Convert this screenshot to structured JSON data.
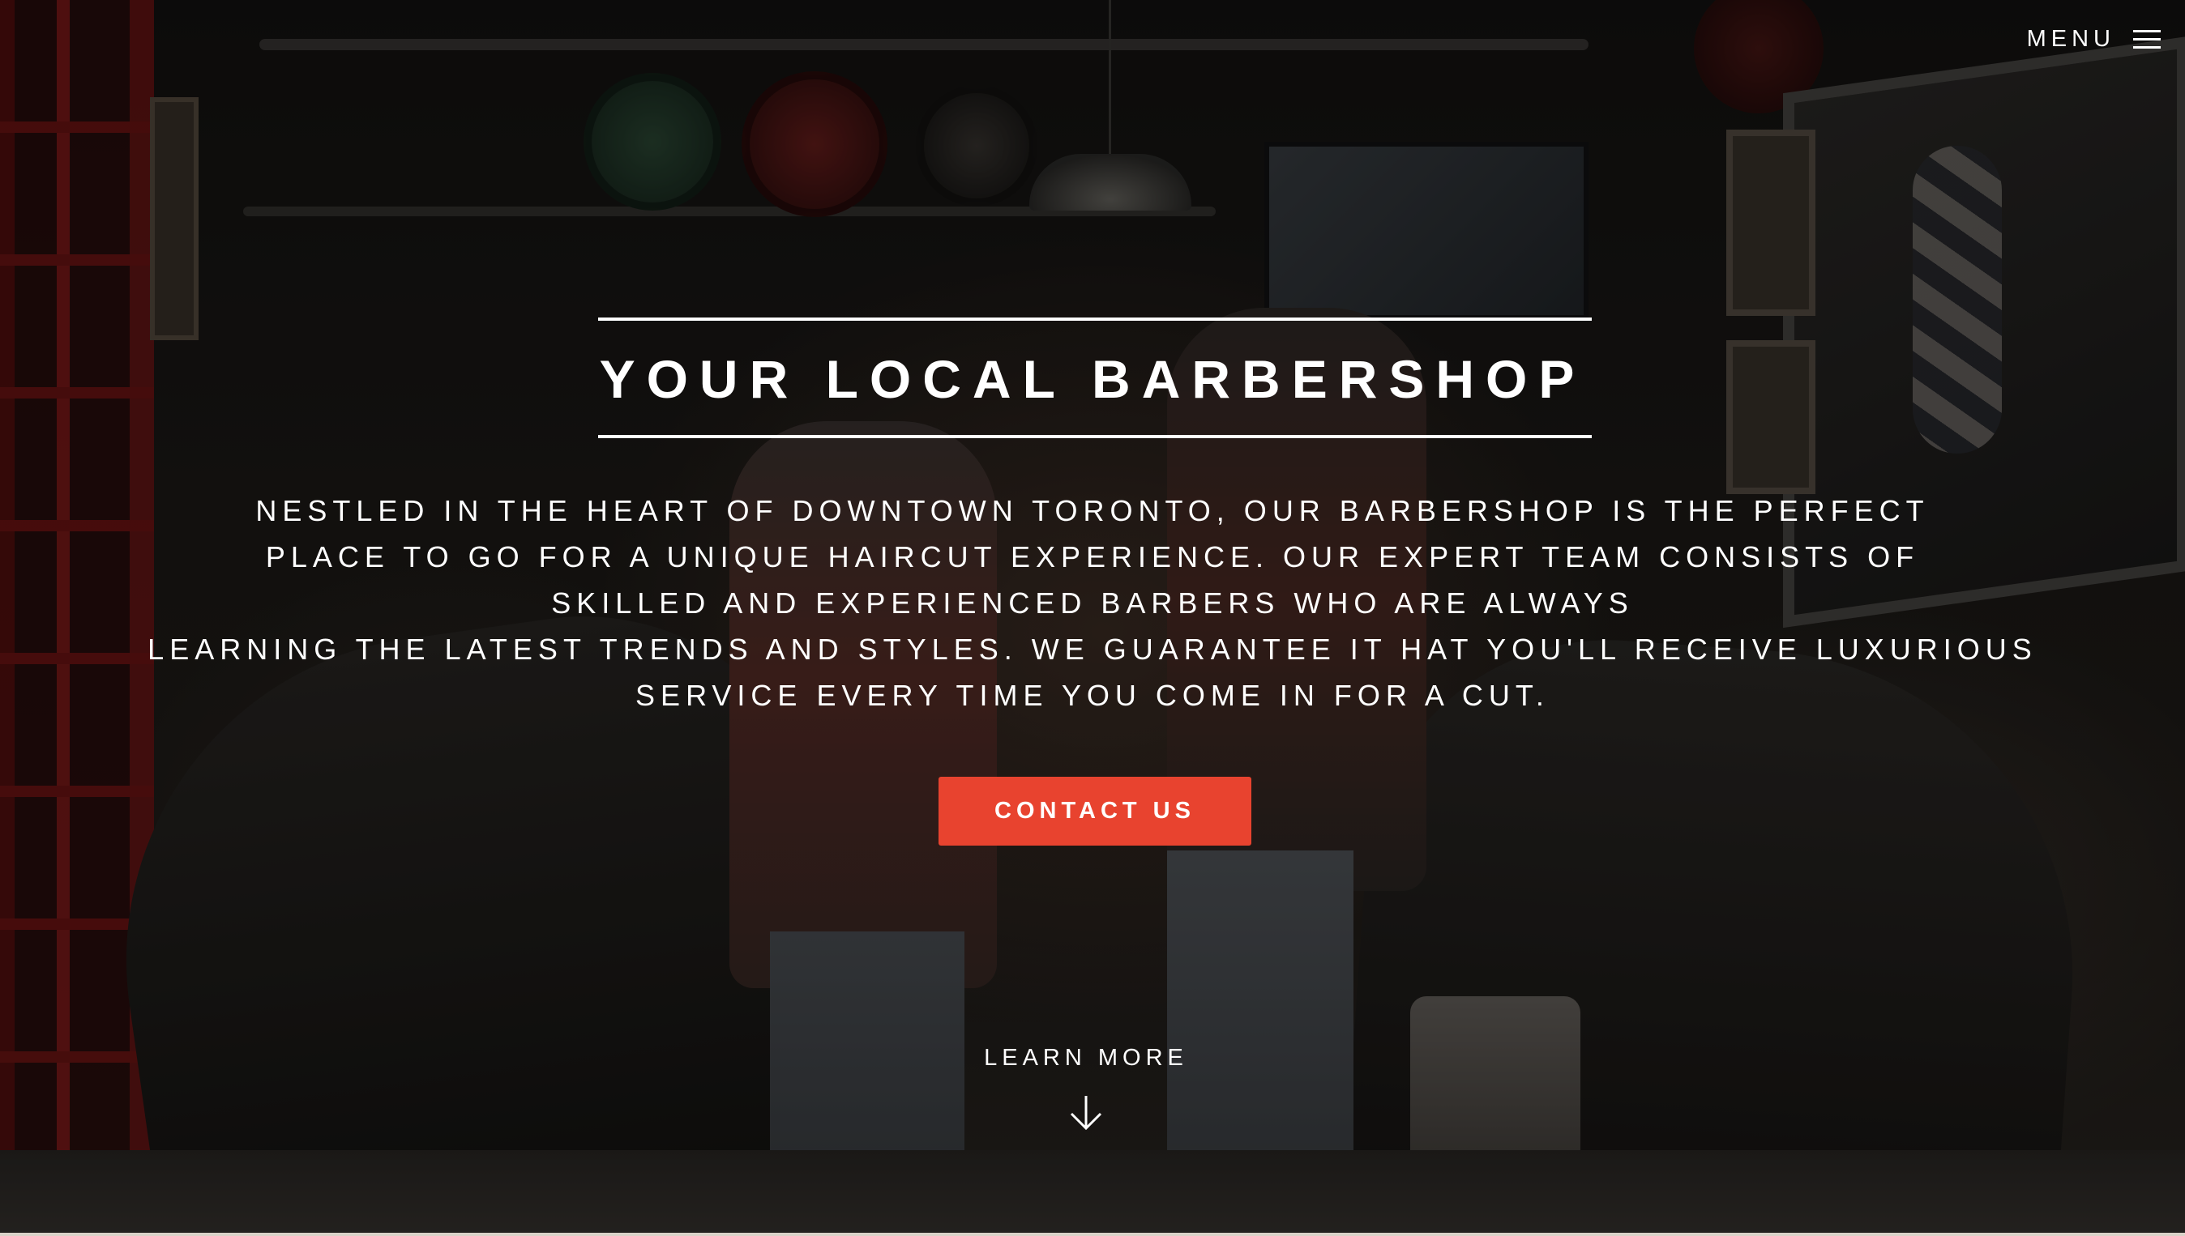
{
  "nav": {
    "menu_label": "MENU",
    "menu_icon": "hamburger-icon"
  },
  "hero": {
    "title": "YOUR LOCAL BARBERSHOP",
    "intro_lines": [
      "NESTLED IN THE HEART OF DOWNTOWN TORONTO, OUR BARBERSHOP IS THE PERFECT",
      "PLACE TO GO FOR A UNIQUE HAIRCUT EXPERIENCE. OUR EXPERT TEAM CONSISTS OF",
      "SKILLED AND EXPERIENCED BARBERS WHO ARE ALWAYS",
      "LEARNING THE LATEST TRENDS AND STYLES. WE GUARANTEE IT HAT YOU'LL RECEIVE LUXURIOUS",
      "SERVICE EVERY TIME YOU COME IN FOR A CUT."
    ],
    "contact_button_label": "CONTACT US",
    "learn_more_label": "LEARN MORE",
    "learn_more_icon": "arrow-down-icon"
  },
  "colors": {
    "accent": "#e8432f",
    "text": "#ffffff",
    "overlay": "#000000"
  }
}
